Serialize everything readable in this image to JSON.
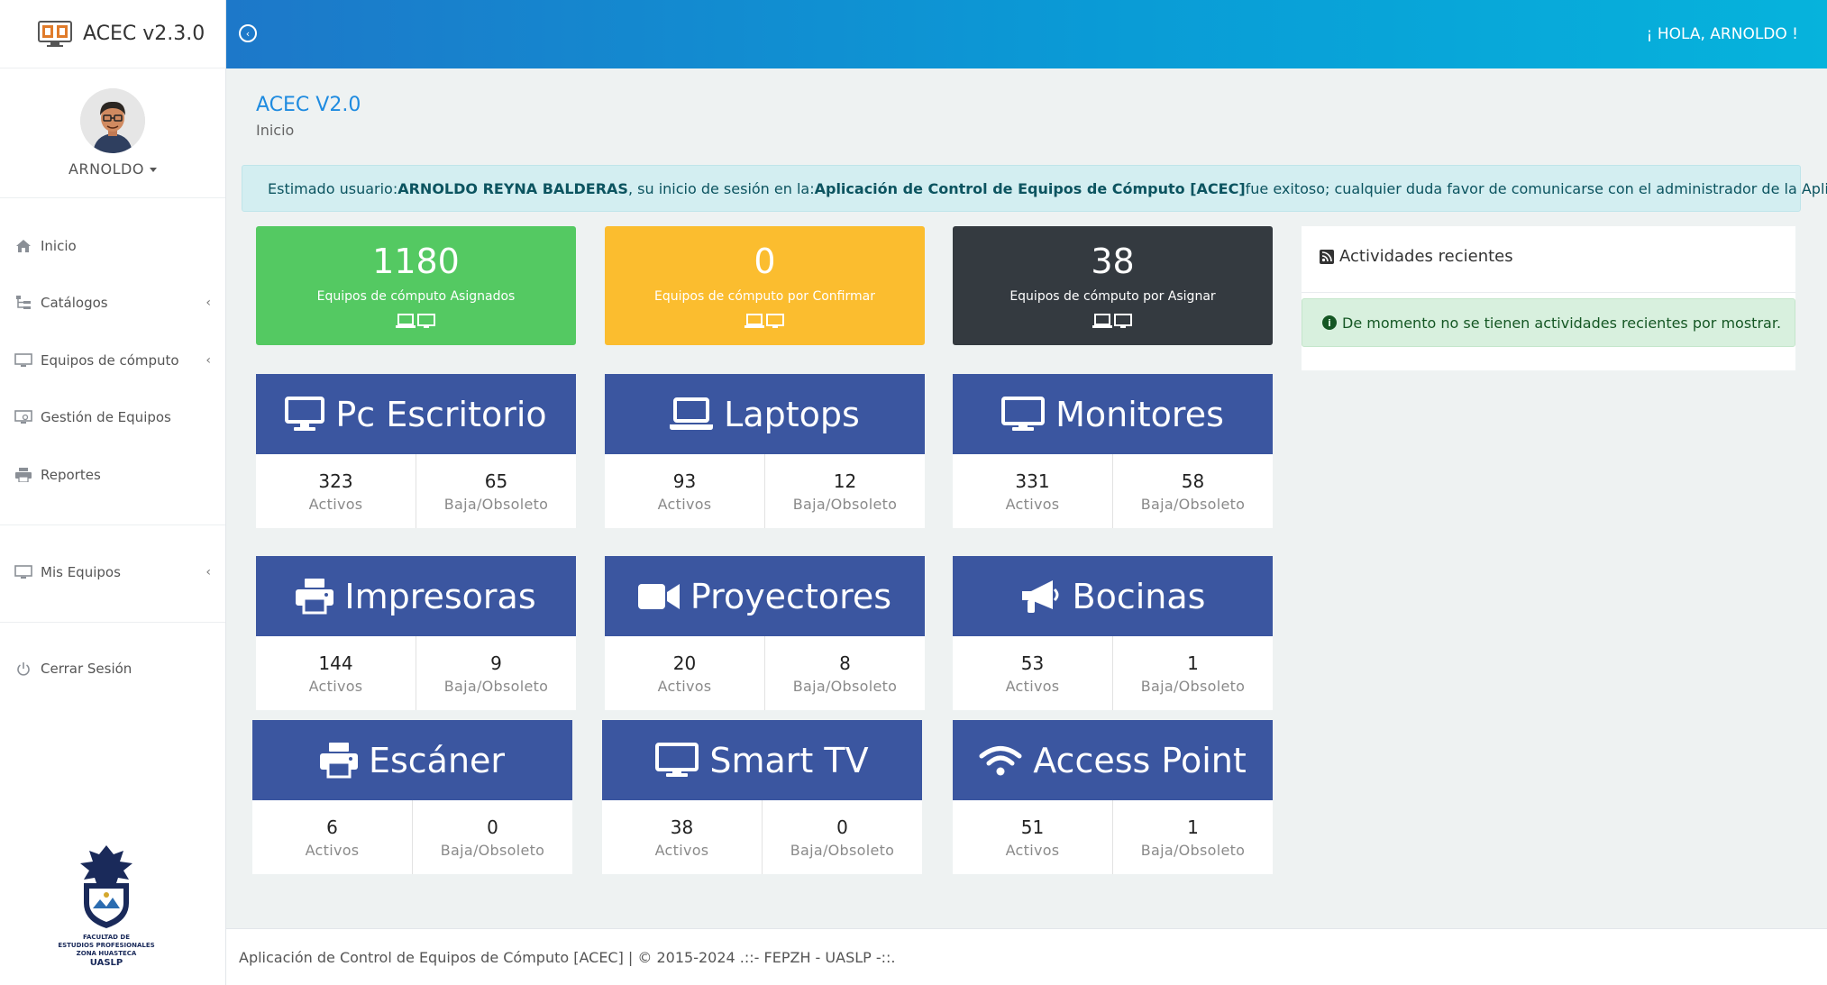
{
  "app": {
    "title": "ACEC v2.3.0"
  },
  "user": {
    "name": "ARNOLDO"
  },
  "topbar": {
    "greeting": "¡ HOLA, ARNOLDO !"
  },
  "sidebar": {
    "items": [
      {
        "label": "Inicio",
        "icon": "home-icon"
      },
      {
        "label": "Catálogos",
        "icon": "sitemap-icon"
      },
      {
        "label": "Equipos de cómputo",
        "icon": "desktop-icon"
      },
      {
        "label": "Gestión de Equipos",
        "icon": "desktop-search-icon"
      },
      {
        "label": "Reportes",
        "icon": "printer-icon"
      },
      {
        "label": "Mis Equipos",
        "icon": "desktop-icon"
      },
      {
        "label": "Cerrar Sesión",
        "icon": "power-icon"
      }
    ],
    "chevron": "‹",
    "faculty": {
      "line1": "FACULTAD DE",
      "line2": "ESTUDIOS PROFESIONALES",
      "line3": "ZONA HUASTECA",
      "line4": "UASLP"
    }
  },
  "page": {
    "title": "ACEC V2.0",
    "breadcrumb": "Inicio"
  },
  "alert": {
    "prefix": "Estimado usuario: ",
    "user_full": "ARNOLDO REYNA BALDERAS",
    "middle": ", su inicio de sesión en la: ",
    "app_name": "Aplicación de Control de Equipos de Cómputo [ACEC]",
    "suffix": " fue exitoso; cualquier duda favor de comunicarse con el administrador de la Aplicación."
  },
  "stats": [
    {
      "value": "1180",
      "label": "Equipos de cómputo Asignados",
      "color": "#54c962"
    },
    {
      "value": "0",
      "label": "Equipos de cómputo por Confirmar",
      "color": "#fbbd2f"
    },
    {
      "value": "38",
      "label": "Equipos de cómputo por Asignar",
      "color": "#343a40"
    }
  ],
  "categories": [
    {
      "name": "Pc Escritorio",
      "icon": "desktop-icon",
      "active": "323",
      "inactive": "65"
    },
    {
      "name": "Laptops",
      "icon": "laptop-icon",
      "active": "93",
      "inactive": "12"
    },
    {
      "name": "Monitores",
      "icon": "monitor-icon",
      "active": "331",
      "inactive": "58"
    },
    {
      "name": "Impresoras",
      "icon": "printer-icon",
      "active": "144",
      "inactive": "9"
    },
    {
      "name": "Proyectores",
      "icon": "video-camera-icon",
      "active": "20",
      "inactive": "8"
    },
    {
      "name": "Bocinas",
      "icon": "bullhorn-icon",
      "active": "53",
      "inactive": "1"
    },
    {
      "name": "Escáner",
      "icon": "printer-icon",
      "active": "6",
      "inactive": "0"
    },
    {
      "name": "Smart TV",
      "icon": "tv-icon",
      "active": "38",
      "inactive": "0"
    },
    {
      "name": "Access Point",
      "icon": "wifi-icon",
      "active": "51",
      "inactive": "1"
    }
  ],
  "labels": {
    "active": "Activos",
    "inactive": "Baja/Obsoleto"
  },
  "recent": {
    "title": "Actividades recientes",
    "empty": "De momento no se tienen actividades recientes por mostrar."
  },
  "footer": {
    "text": "Aplicación de Control de Equipos de Cómputo [ACEC] | © 2015-2024 .::- FEPZH - UASLP -::."
  },
  "colors": {
    "accent": "#1e8be0",
    "card_header": "#3b56a0"
  }
}
